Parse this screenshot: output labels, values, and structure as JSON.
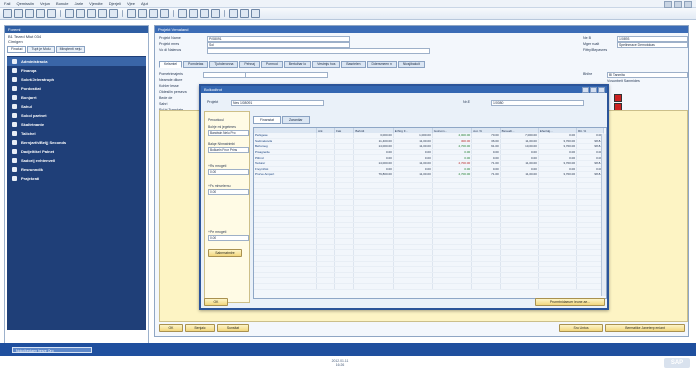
{
  "menu": [
    "Fail",
    "Qemissiin",
    "Vejun",
    "Bonule",
    "Jarle",
    "Vjendte",
    "Djerjeli",
    "Vjee",
    "Ajut"
  ],
  "sidebar": {
    "title": "Foremi",
    "info": [
      "B1 Tezed Miut 034",
      "Cimigen"
    ],
    "tabs": [
      "Finalud",
      "Tupt je Molu",
      "Minqtenti neju"
    ],
    "modules": [
      "Administracia",
      "Finanqa",
      "Sokrt/Jeleratruph",
      "Pordostiat",
      "Bonjarrt",
      "Sahul",
      "Sokol partnet",
      "Skaltrtnante",
      "Talichel",
      "Bernjarth/Beljj Seconds",
      "Dadjeltike/ Palnet",
      "Sadorij evhtenvell",
      "Resrunndik",
      "Prajekrati"
    ],
    "selected_index": 0
  },
  "main": {
    "title": "Projekt Vrmaland",
    "fields": [
      {
        "label": "Projekt Name",
        "value": "P/08091"
      },
      {
        "label": "Projekt mres",
        "value": "Sol"
      },
      {
        "label": "Vo di Nalenos",
        "value": ""
      }
    ],
    "right_fields": [
      {
        "label": "Ne B",
        "value": "1/0893"
      },
      {
        "label": "Mger rualt",
        "value": "Spelinmace Demotokas"
      },
      {
        "label": "Fittry/Bepavres",
        "value": ""
      }
    ],
    "tabs": [
      "Kelsmtel",
      "Pomdetas",
      "Tjuhderonna",
      "Pehnaj",
      "Pormod",
      "Bertuihar lo",
      "Vestmjs hos",
      "Basrielen",
      "Ddersmeen n",
      "Nicsjibakcit"
    ],
    "sub_left": [
      "Pometrimajeris",
      "Neamde diiure",
      "Kohler lesse",
      "Oldesilin perseva",
      "Bede de",
      "Sahri",
      "Rd bi Tumplate"
    ],
    "status_label": "Bhihe",
    "status_value": "Bl Tanmita",
    "check_label": "Vcsunbeit Sanmides",
    "buttons": {
      "ok": "OK",
      "apply": "Benjaic",
      "cancel": "Sunsitat",
      "right1": "Sru Untus",
      "right2": "Bermatike Janeterp eniant"
    },
    "chip_colors": [
      "#cc2222",
      "#cc2222",
      "#22aa33"
    ]
  },
  "dialog": {
    "title": "Bolkodtrot",
    "proj_label": "Projekt",
    "proj_value": "Nes 1/08091",
    "nr_label": "Nr.E",
    "nr_value": "1/0080",
    "tabs": [
      "Finanstat",
      "Zarantiar"
    ],
    "left_labels": [
      "Perowkoul",
      "Bolrje mi jegetmes",
      "Bandeln Nerlo Prod",
      "Balqe Nhmatrimbi",
      "Bolkeln Peor Perint",
      "+Rs mrogeti",
      "+Fs mhvelernu",
      "+Pe mrogeti"
    ],
    "left_values": [
      "Bandwin Nelu Pro",
      "Bolkarln Fnor Prins",
      "0.00",
      "0.00",
      "0.00"
    ],
    "left_button": "Sabrmatmlre",
    "columns": [
      "Ark",
      "Fak",
      "Bahrdt",
      "Erhtrg fr...",
      "Gutrunn...",
      "Aut. %",
      "Bsraudt...",
      "Eherldg...",
      "Rtt. %"
    ],
    "rows": [
      {
        "name": "Perkgese",
        "a": "",
        "b": "3,000.00",
        "c": "1,000.00",
        "d": "2,000.00",
        "e": "70.00",
        "f": "7,000.00",
        "g": "0.00",
        "h": "0.00",
        "neg": false
      },
      {
        "name": "Sodmekovits",
        "a": "",
        "b": "11,400.00",
        "c": "11,00.00",
        "d": "300.00",
        "e": "36.00",
        "f": "11,00.00",
        "g": "3,700.00",
        "h": "98.8+",
        "neg": true
      },
      {
        "name": "Behsmeg",
        "a": "",
        "b": "14,000.00",
        "c": "11,00.00",
        "d": "2,700.00",
        "e": "91.00",
        "f": "10,00.00",
        "g": "3,700.00",
        "h": "98.8+",
        "neg": false
      },
      {
        "name": "Prsagrerde",
        "a": "",
        "b": "0.00",
        "c": "0.00",
        "d": "0.00",
        "e": "0.00",
        "f": "0.00",
        "g": "0.00",
        "h": "0.00",
        "neg": false
      },
      {
        "name": "Pitbnd",
        "a": "",
        "b": "0.00",
        "c": "0.00",
        "d": "0.00",
        "e": "0.00",
        "f": "0.00",
        "g": "0.00",
        "h": "0.00",
        "neg": false
      },
      {
        "name": "Tedurer",
        "a": "",
        "b": "14,000.00",
        "c": "11,00.00",
        "d": "2,700.00",
        "e": "71.00",
        "f": "11,00.00",
        "g": "3,700.00",
        "h": "98.8+",
        "neg": true
      },
      {
        "name": "Freyrnhist",
        "a": "",
        "b": "0.00",
        "c": "0.00",
        "d": "0.00",
        "e": "0.00",
        "f": "0.00",
        "g": "0.00",
        "h": "0.00",
        "neg": false
      },
      {
        "name": "Prurve Ampert",
        "a": "",
        "b": "79,800.00",
        "c": "11,00.00",
        "d": "2,700.00",
        "e": "71.00",
        "f": "11,00.00",
        "g": "3,700.00",
        "h": "98.8+",
        "neg": false
      }
    ],
    "ok": "OK",
    "right_button": "Prurmtnidaeuer leune ae..."
  },
  "taskbar": {
    "item": "Nokoikeclaen hesre Oro",
    "date": "2012.01.11",
    "time": "16:26",
    "logo": "SAP"
  }
}
